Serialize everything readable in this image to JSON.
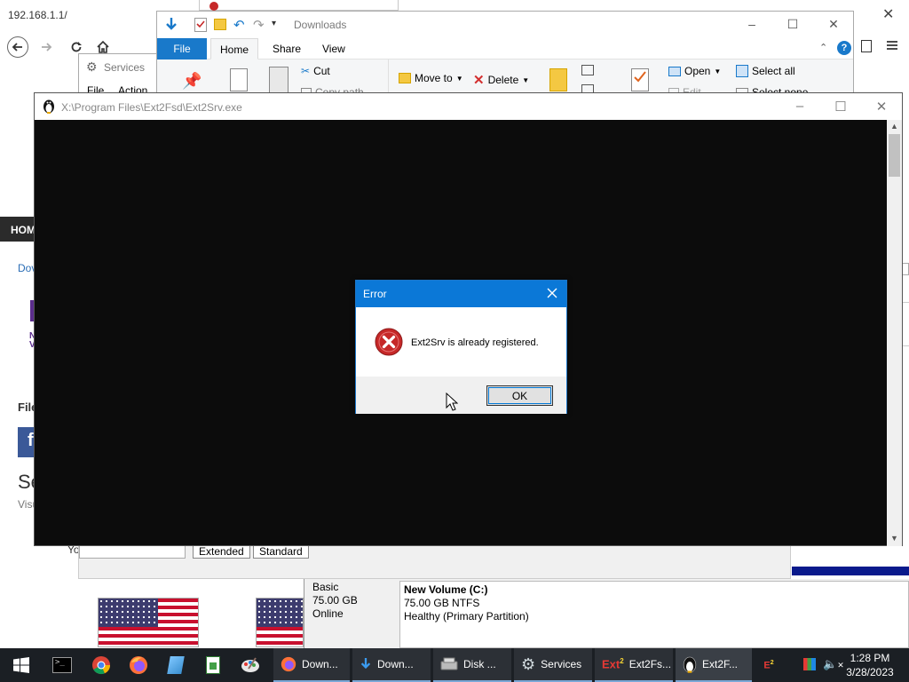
{
  "browser": {
    "url": "192.168.1.1/",
    "web_nav": "HOM",
    "side_link": "Dov",
    "side_brand": "N\nV",
    "side_heading": "File",
    "side_big": "Se",
    "side_sub": "Visu",
    "side_bottom": "Yo"
  },
  "disk_mgmt": {
    "tabs": [
      "Extended",
      "Standard"
    ],
    "disk_type": "Basic",
    "disk_size": "75.00 GB",
    "disk_status": "Online",
    "volume_name": "New Volume  (C:)",
    "volume_size": "75.00 GB NTFS",
    "volume_health": "Healthy (Primary Partition)"
  },
  "explorer": {
    "title": "Downloads",
    "menu": {
      "file": "File",
      "home": "Home",
      "share": "Share",
      "view": "View"
    },
    "ribbon": {
      "cut": "Cut",
      "copy_path": "Copy path",
      "move_to": "Move to",
      "delete": "Delete",
      "open": "Open",
      "edit": "Edit",
      "select_all": "Select all",
      "select_none": "Select none"
    }
  },
  "services": {
    "title": "Services",
    "menu_file": "File",
    "menu_action": "Action"
  },
  "console": {
    "title": "X:\\Program Files\\Ext2Fsd\\Ext2Srv.exe"
  },
  "dialog": {
    "title": "Error",
    "message": "Ext2Srv is already registered.",
    "ok_label": "OK",
    "icon": "error-icon"
  },
  "taskbar": {
    "tasks": [
      {
        "label": "Down...",
        "icon": "firefox-icon"
      },
      {
        "label": "Down...",
        "icon": "download-arrow-icon"
      },
      {
        "label": "Disk ...",
        "icon": "disk-icon"
      },
      {
        "label": "Services",
        "icon": "gear-icon"
      },
      {
        "label": "Ext2Fs...",
        "icon": "ext2-icon"
      },
      {
        "label": "Ext2F...",
        "icon": "penguin-icon"
      }
    ],
    "time": "1:28 PM",
    "date": "3/28/2023"
  },
  "colors": {
    "taskbar": "#1b1f24",
    "dialog_titlebar": "#0b78d7",
    "ribbon_file": "#1979ca",
    "console_bg": "#0c0c0c"
  }
}
